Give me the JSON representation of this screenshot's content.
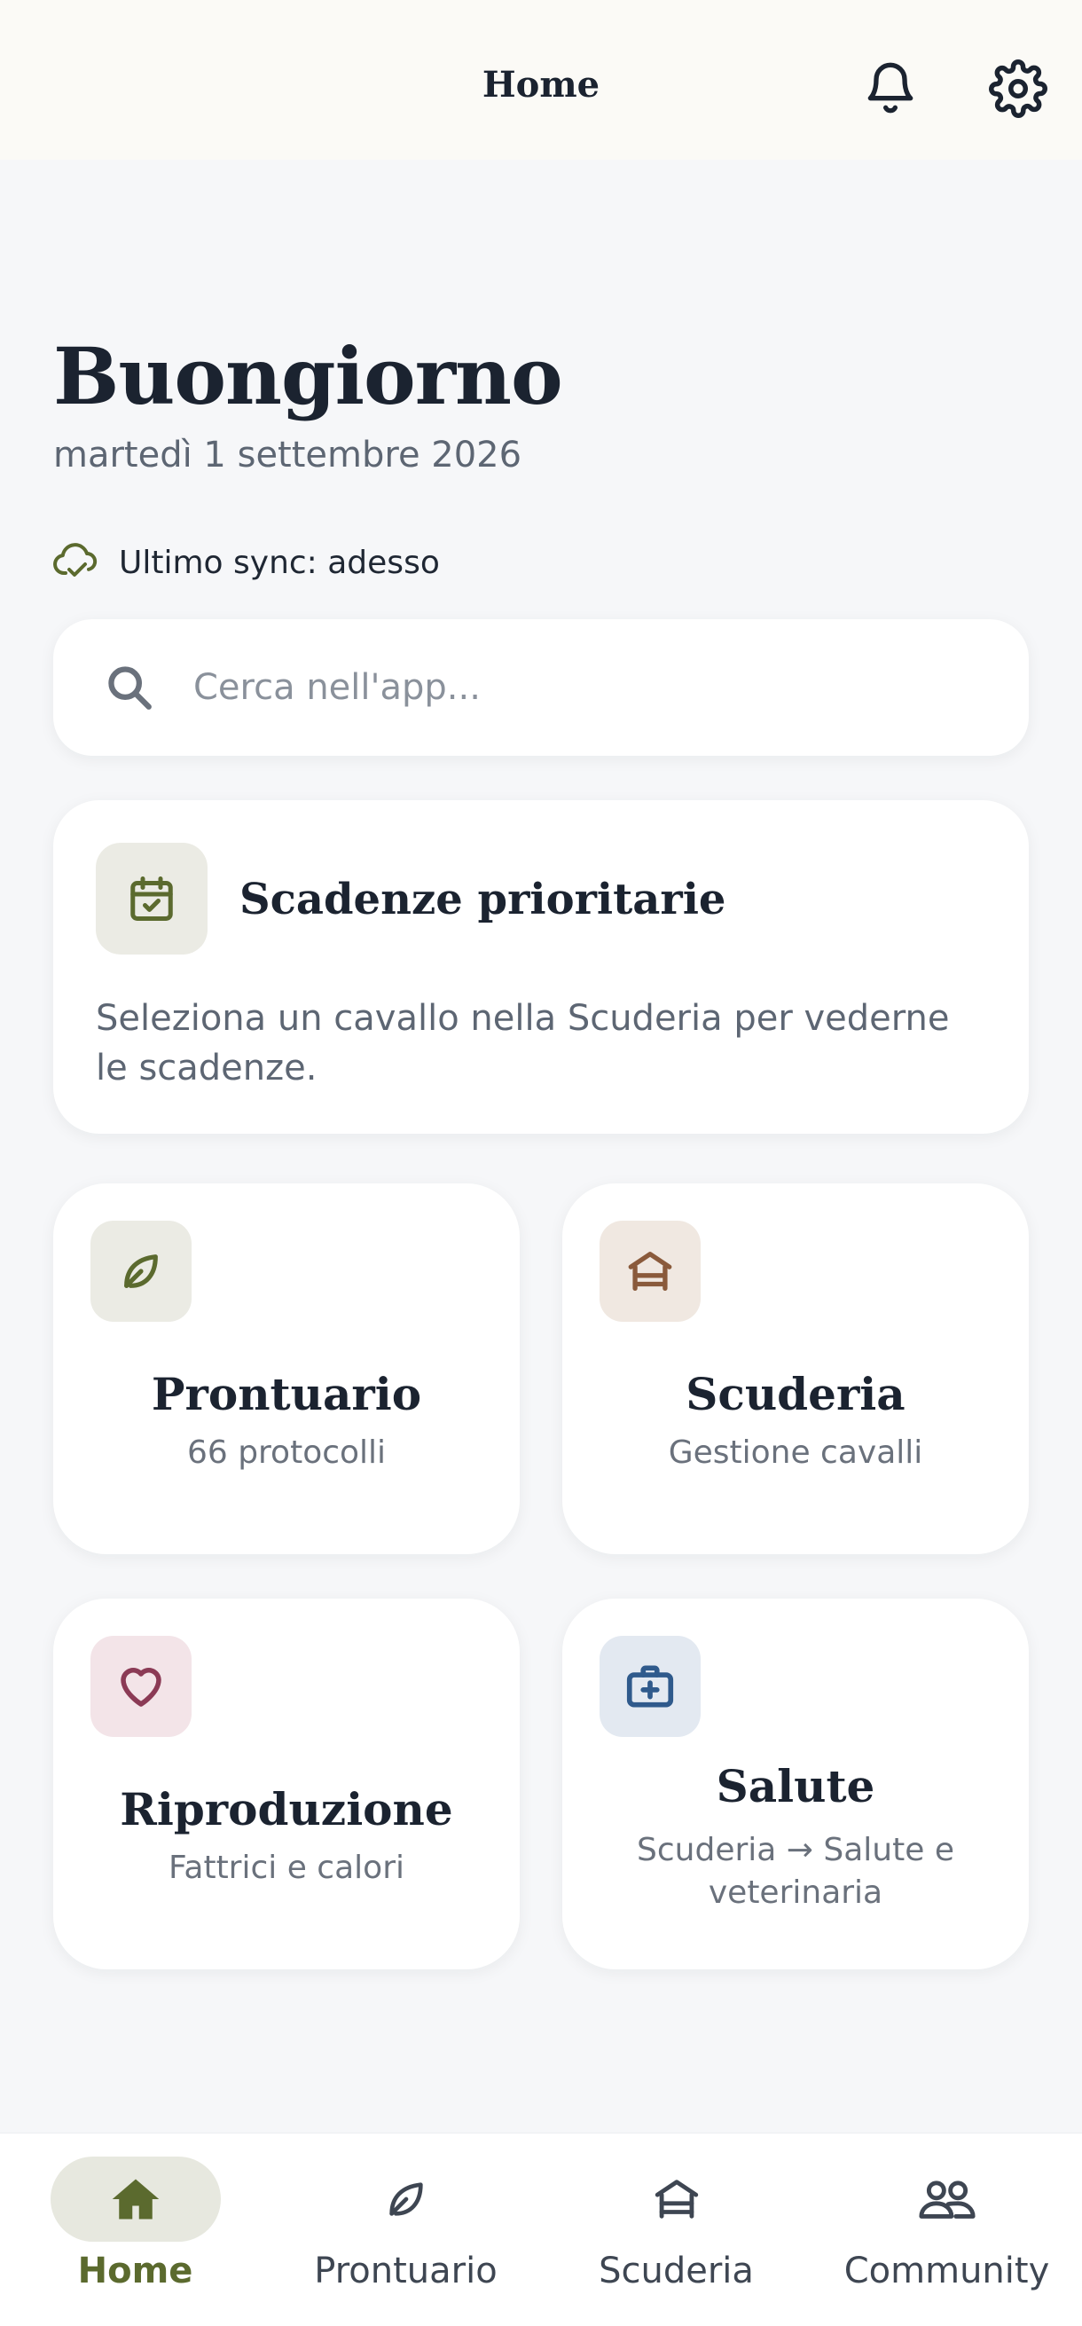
{
  "header": {
    "title": "Home",
    "icons": {
      "notifications": "bell-icon",
      "settings": "gear-icon"
    }
  },
  "greeting": {
    "title": "Buongiorno",
    "date": "martedì 1 settembre 2026"
  },
  "sync": {
    "label": "Ultimo sync: adesso",
    "icon": "cloud-check-icon"
  },
  "search": {
    "placeholder": "Cerca nell'app...",
    "value": ""
  },
  "priority": {
    "title": "Scadenze prioritarie",
    "text": "Seleziona un cavallo nella Scuderia per vederne le scadenze.",
    "icon": "calendar-check-icon"
  },
  "tiles": [
    {
      "title": "Prontuario",
      "subtitle": "66 protocolli",
      "icon": "leaf-icon"
    },
    {
      "title": "Scuderia",
      "subtitle": "Gestione cavalli",
      "icon": "stable-icon"
    },
    {
      "title": "Riproduzione",
      "subtitle": "Fattrici e calori",
      "icon": "heart-icon"
    },
    {
      "title": "Salute",
      "subtitle": "Scuderia → Salute e veterinaria",
      "icon": "medical-kit-icon"
    }
  ],
  "bottom_nav": {
    "active": "Home",
    "items": [
      {
        "label": "Home",
        "icon": "home-icon"
      },
      {
        "label": "Prontuario",
        "icon": "leaf-icon"
      },
      {
        "label": "Scuderia",
        "icon": "stable-icon"
      },
      {
        "label": "Community",
        "icon": "people-icon"
      }
    ]
  },
  "colors": {
    "accent_olive": "#5b6a2e",
    "stable_brown": "#8a5a3b",
    "heart_red": "#8b3a55",
    "medical_blue": "#2f5a8c",
    "background": "#f6f7f9"
  }
}
